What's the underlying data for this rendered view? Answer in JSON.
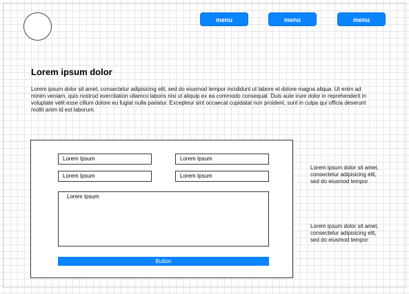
{
  "header": {
    "menu_items": [
      {
        "label": "menu"
      },
      {
        "label": "menu"
      },
      {
        "label": "menu"
      }
    ]
  },
  "content": {
    "heading": "Lorem ipsum dolor",
    "paragraph": "Lorem ipsum dolor sit amet, consectetur adipisicing elit, sed do eiusmod tempor incididunt ut labore et dolore magna aliqua. Ut enim ad minim veniam, quis nostrud exercitation ullamco laboris nisi ut aliquip ex ea commodo consequat. Duis aute irure dolor in reprehenderit in voluptate velit esse cillum dolore eu fugiat nulla pariatur. Excepteur sint occaecat cupidatat non proident, sunt in culpa qui officia deserunt mollit anim id est laborum."
  },
  "form": {
    "fields": [
      {
        "placeholder": "Lorem Ipsum"
      },
      {
        "placeholder": "Lorem Ipsum"
      },
      {
        "placeholder": "Lorem Ipsum"
      },
      {
        "placeholder": "Lorem Ipsum"
      }
    ],
    "textarea_placeholder": "Lorem Ipsum",
    "button_label": "Button"
  },
  "side_notes": [
    "Lorem ipsum dolor sit amet, consectetur adipisicing elit, sed do eiusmod tempor",
    "Lorem ipsum dolor sit amet, consectetur adipisicing elit, sed do eiusmod tempor"
  ],
  "colors": {
    "accent": "#0a84ff",
    "grid": "#e6e6e6",
    "border": "#333333"
  }
}
